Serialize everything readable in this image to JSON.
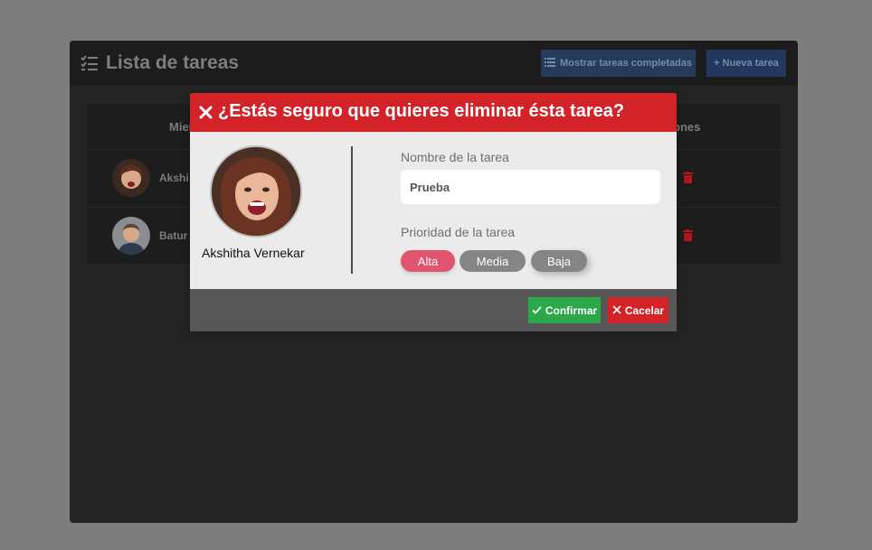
{
  "panel": {
    "title": "Lista de tareas",
    "title_icon": "checklist-icon",
    "show_completed_label": "Mostrar tareas completadas",
    "new_task_label": "+ Nueva tarea"
  },
  "table": {
    "headers": {
      "member": "Mien",
      "actions": "ones"
    },
    "rows": [
      {
        "name": "Akshi",
        "action_icon": "trash-icon"
      },
      {
        "name": "Batur",
        "action_icon": "trash-icon"
      }
    ]
  },
  "modal": {
    "title": "¿Estás seguro que quieres eliminar ésta tarea?",
    "member_name": "Akshitha Vernekar",
    "task_name_label": "Nombre de la tarea",
    "task_name_value": "Prueba",
    "priority_label": "Prioridad de la tarea",
    "priorities": [
      "Alta",
      "Media",
      "Baja"
    ],
    "selected_priority": "Alta",
    "confirm_label": "Confirmar",
    "cancel_label": "Cacelar"
  },
  "colors": {
    "danger": "#d42328",
    "success": "#2aa84a",
    "priority_high": "#e0546d",
    "priority_neutral": "#858585"
  }
}
